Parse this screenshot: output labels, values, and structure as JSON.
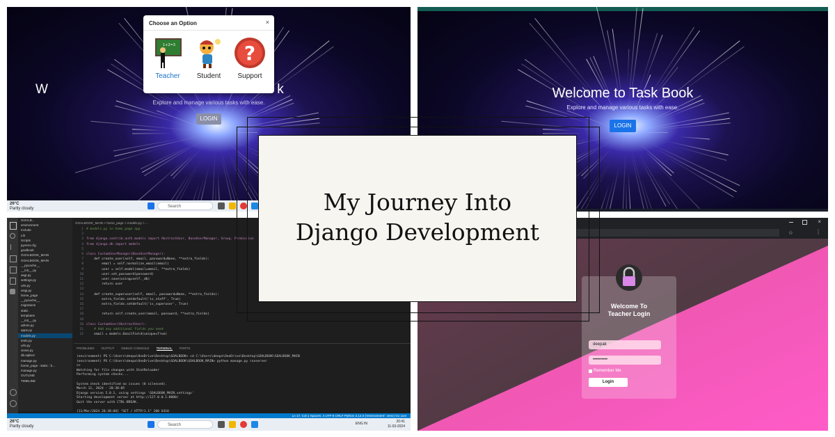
{
  "title": {
    "line1": "My Journey Into",
    "line2": "Django Development"
  },
  "panel_tl": {
    "modal": {
      "title": "Choose an Option",
      "close": "×",
      "options": [
        {
          "label": "Teacher",
          "color": "#1a73c8"
        },
        {
          "label": "Student",
          "color": "#222222"
        },
        {
          "label": "Support",
          "color": "#222222"
        }
      ]
    },
    "hero_title_fragment": "W",
    "hero_title_tail": "k",
    "hero_sub": "Explore and manage various tasks with ease.",
    "login": "LOGIN",
    "taskbar": {
      "temp": "26°C",
      "weather": "Partly cloudy",
      "search": "Search"
    }
  },
  "panel_tr": {
    "hero_title": "Welcome to Task Book",
    "hero_sub": "Explore and manage various tasks with ease.",
    "login": "LOGIN"
  },
  "panel_bl": {
    "tab": "models.py",
    "breadcrumb": "GOALBOOK_MAIN > home_page > models.py > ...",
    "explorer": [
      "GOALB...",
      "environment",
      "Include",
      "Lib",
      "Scripts",
      "pyvenv.cfg",
      "goalbook",
      "GOALBOOK_MAIN",
      "GOALBOOK_MAIN",
      "__pycache__",
      "__init__.py",
      "asgi.py",
      "settings.py",
      "urls.py",
      "wsgi.py",
      "home_page",
      "__pycache__",
      "migrations",
      "static",
      "templates",
      "__init__.py",
      "admin.py",
      "apps.py",
      "models.py",
      "tests.py",
      "urls.py",
      "views.py",
      "db.sqlite3",
      "manage.py",
      "home_page : static : b...",
      "manage.py",
      "OUTLINE",
      "TIMELINE"
    ],
    "code": [
      "# models.py in home_page app",
      "",
      "from django.contrib.auth.models import AbstractUser, BaseUserManager, Group, Permission",
      "from django.db import models",
      "",
      "class CustomUserManager(BaseUserManager):",
      "    def create_user(self, email, password=None, **extra_fields):",
      "        email = self.normalize_email(email)",
      "        user = self.model(email=email, **extra_fields)",
      "        user.set_password(password)",
      "        user.save(using=self._db)",
      "        return user",
      "",
      "    def create_superuser(self, email, password=None, **extra_fields):",
      "        extra_fields.setdefault('is_staff', True)",
      "        extra_fields.setdefault('is_superuser', True)",
      "",
      "        return self.create_user(email, password, **extra_fields)",
      "",
      "class CustomUser(AbstractUser):",
      "    # Add any additional fields you need",
      "    email = models.EmailField(unique=True)"
    ],
    "terminal_tabs": [
      "PROBLEMS",
      "OUTPUT",
      "DEBUG CONSOLE",
      "TERMINAL",
      "PORTS"
    ],
    "terminal": [
      "(environment) PS C:\\Users\\deepa\\OneDrive\\Desktop\\GOALBOOK> cd C:\\Users\\deepa\\OneDrive\\Desktop\\GOALBOOK\\GOALBOOK_MAIN",
      "(environment) PS C:\\Users\\deepa\\OneDrive\\Desktop\\GOALBOOK\\GOALBOOK_MAIN> python manage.py runserver",
      ">>",
      "Watching for file changes with StatReloader",
      "Performing system checks...",
      "",
      "System check identified no issues (0 silenced).",
      "March 11, 2024 - 20:38:05",
      "Django version 5.0.1, using settings 'GOALBOOK_MAIN.settings'",
      "Starting development server at http://127.0.0.1:8000/",
      "Quit the server with CTRL-BREAK.",
      "",
      "[11/Mar/2024 20:38:08] \"GET / HTTP/1.1\" 200 6410"
    ],
    "status": "Ln 17, Col 1   Spaces: 4   UTF-8   CRLF   Python   3.12.0 ('environment': venv)   Go Live",
    "taskbar": {
      "temp": "26°C",
      "weather": "Partly cloudy",
      "search": "Search",
      "time": "20:41",
      "date": "11-03-2024",
      "lang": "ENG IN"
    }
  },
  "panel_br": {
    "heading_line1": "Welcome To",
    "heading_line2": "Teacher Login",
    "username": "deepak",
    "password": "••••••••••",
    "remember": "Remember Me",
    "login": "Login"
  }
}
